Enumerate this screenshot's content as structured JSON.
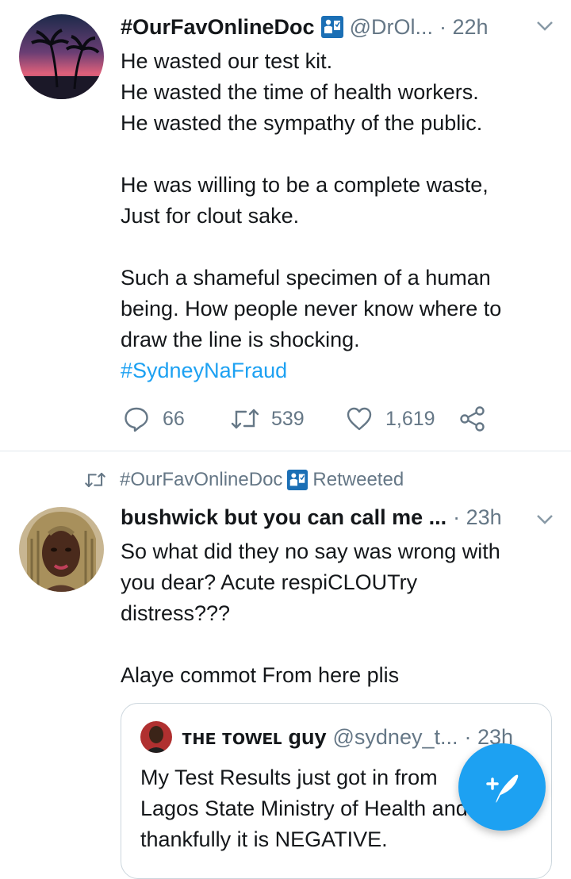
{
  "tweet1": {
    "display_name": "#OurFavOnlineDoc",
    "handle": "@DrOl...",
    "separator": "·",
    "time": "22h",
    "lines": [
      "He wasted our test kit.",
      "He wasted the time of health workers.",
      "He wasted the sympathy of the public.",
      "",
      "He was willing to be a complete waste,",
      "Just for clout sake.",
      "",
      "Such a shameful specimen of a human",
      "being. How people never know where to",
      "draw the line is shocking."
    ],
    "hashtag": "#SydneyNaFraud",
    "replies": "66",
    "retweets": "539",
    "likes": "1,619"
  },
  "retweet_context": {
    "name": "#OurFavOnlineDoc",
    "label": "Retweeted"
  },
  "tweet2": {
    "display_name": "bushwick but you can call me ...",
    "separator": "·",
    "time": "23h",
    "lines": [
      "So what did they no say was wrong with",
      "you dear? Acute respiCLOUTry",
      "distress???",
      "",
      "Alaye commot From here plis"
    ]
  },
  "quoted_tweet": {
    "display_name": "ᴛʜᴇ ᴛᴏᴡᴇʟ guy",
    "handle": "@sydney_t...",
    "separator": "·",
    "time": "23h",
    "lines": [
      "My Test Results just got in from",
      "Lagos State Ministry of Health and",
      "thankfully it is NEGATIVE."
    ]
  },
  "icons": {
    "reply": "reply-icon",
    "retweet": "retweet-icon",
    "like": "heart-icon",
    "share": "share-icon",
    "compose": "compose-tweet-icon",
    "badge": "doctor-badge-icon",
    "chevron": "chevron-down-icon"
  },
  "colors": {
    "accent": "#1da1f2",
    "muted": "#657786",
    "text": "#14171a",
    "divider": "#e1e8ed"
  }
}
